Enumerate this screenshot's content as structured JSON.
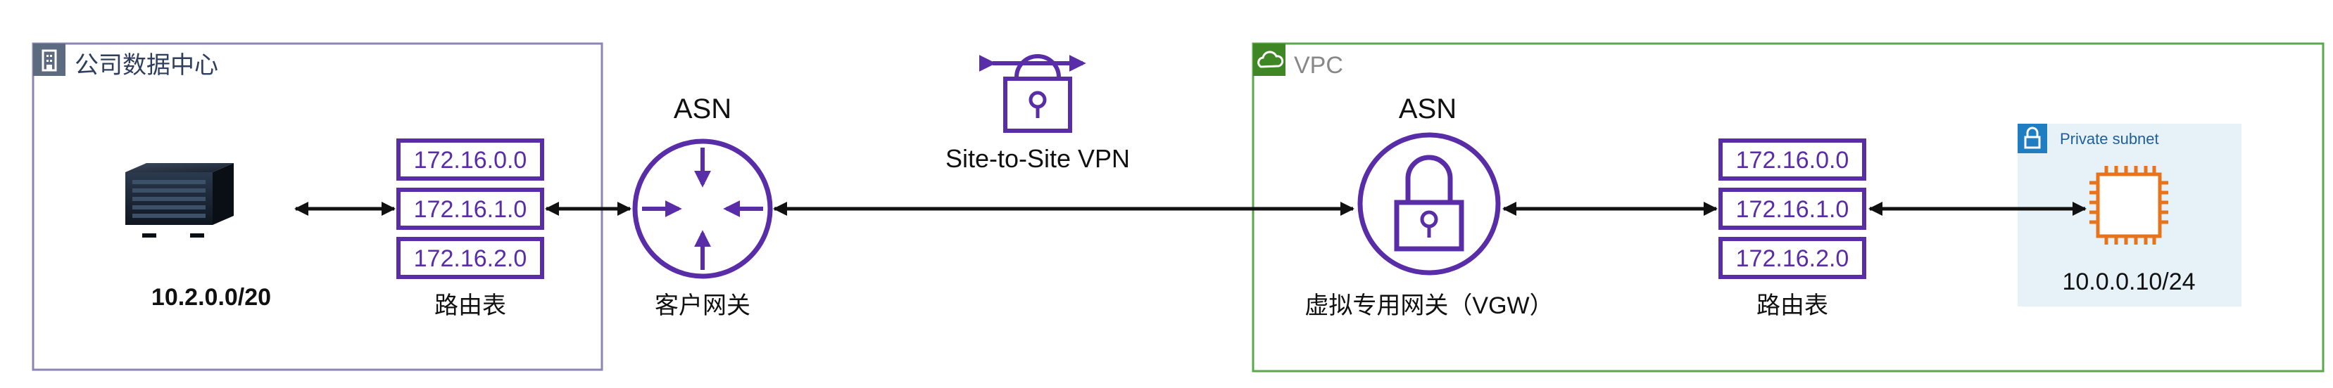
{
  "datacenter": {
    "title": "公司数据中心",
    "server_cidr": "10.2.0.0/20",
    "route_table": {
      "label": "路由表",
      "entries": [
        "172.16.0.0",
        "172.16.1.0",
        "172.16.2.0"
      ]
    },
    "gateway": {
      "asn": "ASN",
      "label": "客户网关"
    }
  },
  "vpn": {
    "label": "Site-to-Site VPN"
  },
  "vpc": {
    "title": "VPC",
    "vgw": {
      "asn": "ASN",
      "label": "虚拟专用网关（VGW）"
    },
    "route_table": {
      "label": "路由表",
      "entries": [
        "172.16.0.0",
        "172.16.1.0",
        "172.16.2.0"
      ]
    },
    "subnet": {
      "label": "Private subnet",
      "instance_cidr": "10.0.0.10/24"
    }
  },
  "colors": {
    "purple": "#5A2DA8",
    "dc_border": "#8C84B5",
    "vpc_border": "#5BA84A",
    "subnet_bg": "#E6F2F8",
    "subnet_icon": "#1F7DC2",
    "ec2": "#E8731B"
  }
}
